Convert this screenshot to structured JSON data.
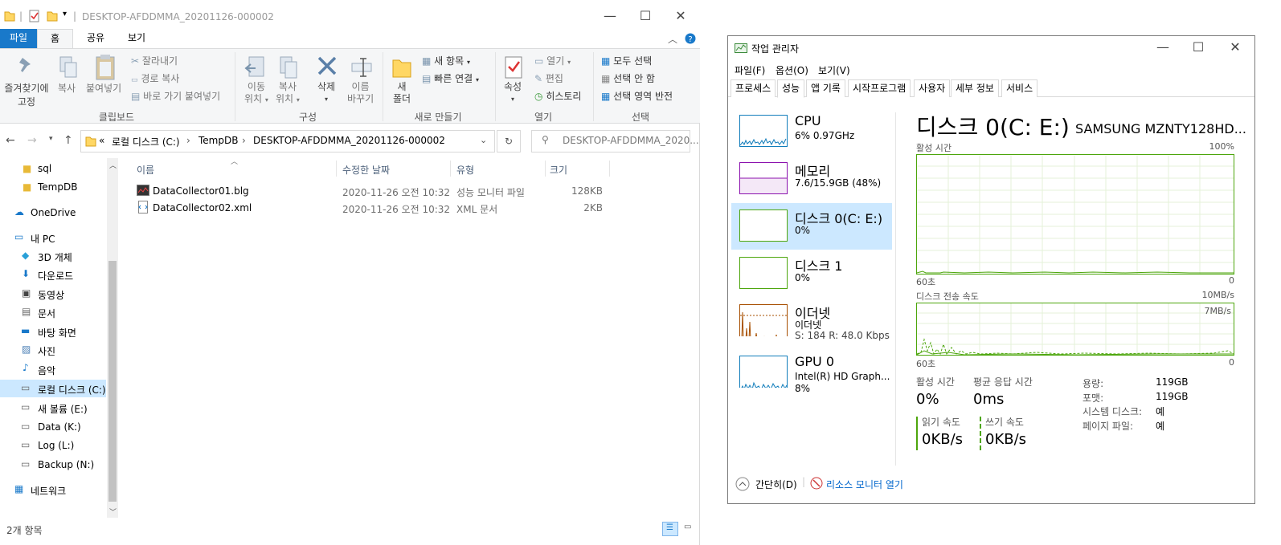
{
  "explorer": {
    "window_title": "DESKTOP-AFDDMMA_20201126-000002",
    "ribbon_tabs": [
      "파일",
      "홈",
      "공유",
      "보기"
    ],
    "clipboard": {
      "pin_label_1": "즐겨찾기에",
      "pin_label_2": "고정",
      "copy_label": "복사",
      "paste_label": "붙여넣기",
      "cut_label": "잘라내기",
      "copy_path_label": "경로 복사",
      "paste_shortcut_label": "바로 가기 붙여넣기",
      "group_label": "클립보드"
    },
    "organize": {
      "move_label_1": "이동",
      "move_label_2": "위치",
      "copyto_label_1": "복사",
      "copyto_label_2": "위치",
      "delete_label": "삭제",
      "rename_label_1": "이름",
      "rename_label_2": "바꾸기",
      "group_label": "구성"
    },
    "new": {
      "folder_label_1": "새",
      "folder_label_2": "폴더",
      "new_item_label": "새 항목",
      "easy_access_label": "빠른 연결",
      "group_label": "새로 만들기"
    },
    "open": {
      "properties_label": "속성",
      "open_label": "열기",
      "edit_label": "편집",
      "history_label": "히스토리",
      "group_label": "열기"
    },
    "select": {
      "select_all_label": "모두 선택",
      "select_none_label": "선택 안 함",
      "invert_label": "선택 영역 반전",
      "group_label": "선택"
    },
    "address": {
      "path": [
        "로컬 디스크 (C:)",
        "TempDB",
        "DESKTOP-AFDDMMA_20201126-000002"
      ],
      "overflow": "«"
    },
    "search_placeholder": "DESKTOP-AFDDMMA_2020...",
    "nav_items": [
      "sql",
      "TempDB",
      "OneDrive",
      "내 PC",
      "3D 개체",
      "다운로드",
      "동영상",
      "문서",
      "바탕 화면",
      "사진",
      "음악",
      "로컬 디스크 (C:)",
      "새 볼륨 (E:)",
      "Data (K:)",
      "Log (L:)",
      "Backup (N:)",
      "네트워크"
    ],
    "columns": [
      "이름",
      "수정한 날짜",
      "유형",
      "크기"
    ],
    "files": [
      {
        "name": "DataCollector01.blg",
        "date": "2020-11-26 오전 10:32",
        "type": "성능 모니터 파일",
        "size": "128KB"
      },
      {
        "name": "DataCollector02.xml",
        "date": "2020-11-26 오전 10:32",
        "type": "XML 문서",
        "size": "2KB"
      }
    ],
    "status": "2개 항목"
  },
  "taskmgr": {
    "title": "작업 관리자",
    "menu": [
      "파일(F)",
      "옵션(O)",
      "보기(V)"
    ],
    "tabs": [
      "프로세스",
      "성능",
      "앱 기록",
      "시작프로그램",
      "사용자",
      "세부 정보",
      "서비스"
    ],
    "side": [
      {
        "name": "CPU",
        "line1": "6% 0.97GHz",
        "line2": ""
      },
      {
        "name": "메모리",
        "line1": "7.6/15.9GB (48%)",
        "line2": ""
      },
      {
        "name": "디스크 0(C: E:)",
        "line1": "0%",
        "line2": ""
      },
      {
        "name": "디스크 1",
        "line1": "0%",
        "line2": ""
      },
      {
        "name": "이더넷",
        "line1": "이더넷",
        "line2": "S: 184  R: 48.0 Kbps"
      },
      {
        "name": "GPU 0",
        "line1": "Intel(R) HD Graph...",
        "line2": "8%"
      }
    ],
    "detail": {
      "title": "디스크 0(C: E:)",
      "model": "SAMSUNG MZNTY128HD...",
      "graph1_label": "활성 시간",
      "graph1_max": "100%",
      "graph1_left": "60초",
      "graph1_right": "0",
      "graph2_label": "디스크 전송 속도",
      "graph2_max": "10MB/s",
      "graph2_inner": "7MB/s",
      "graph2_left": "60초",
      "graph2_right": "0",
      "active_label": "활성 시간",
      "active_value": "0%",
      "resp_label": "평균 응답 시간",
      "resp_value": "0ms",
      "read_label": "읽기 속도",
      "read_value": "0KB/s",
      "write_label": "쓰기 속도",
      "write_value": "0KB/s",
      "props": [
        {
          "k": "용량:",
          "v": "119GB"
        },
        {
          "k": "포맷:",
          "v": "119GB"
        },
        {
          "k": "시스템 디스크:",
          "v": "예"
        },
        {
          "k": "페이지 파일:",
          "v": "예"
        }
      ]
    },
    "footer": {
      "fewer": "간단히(D)",
      "resmon": "리소스 모니터 열기"
    },
    "colors": {
      "disk": "#4da60c",
      "cpu": "#117dbb",
      "mem": "#8b12ae",
      "eth": "#a74f01"
    }
  }
}
